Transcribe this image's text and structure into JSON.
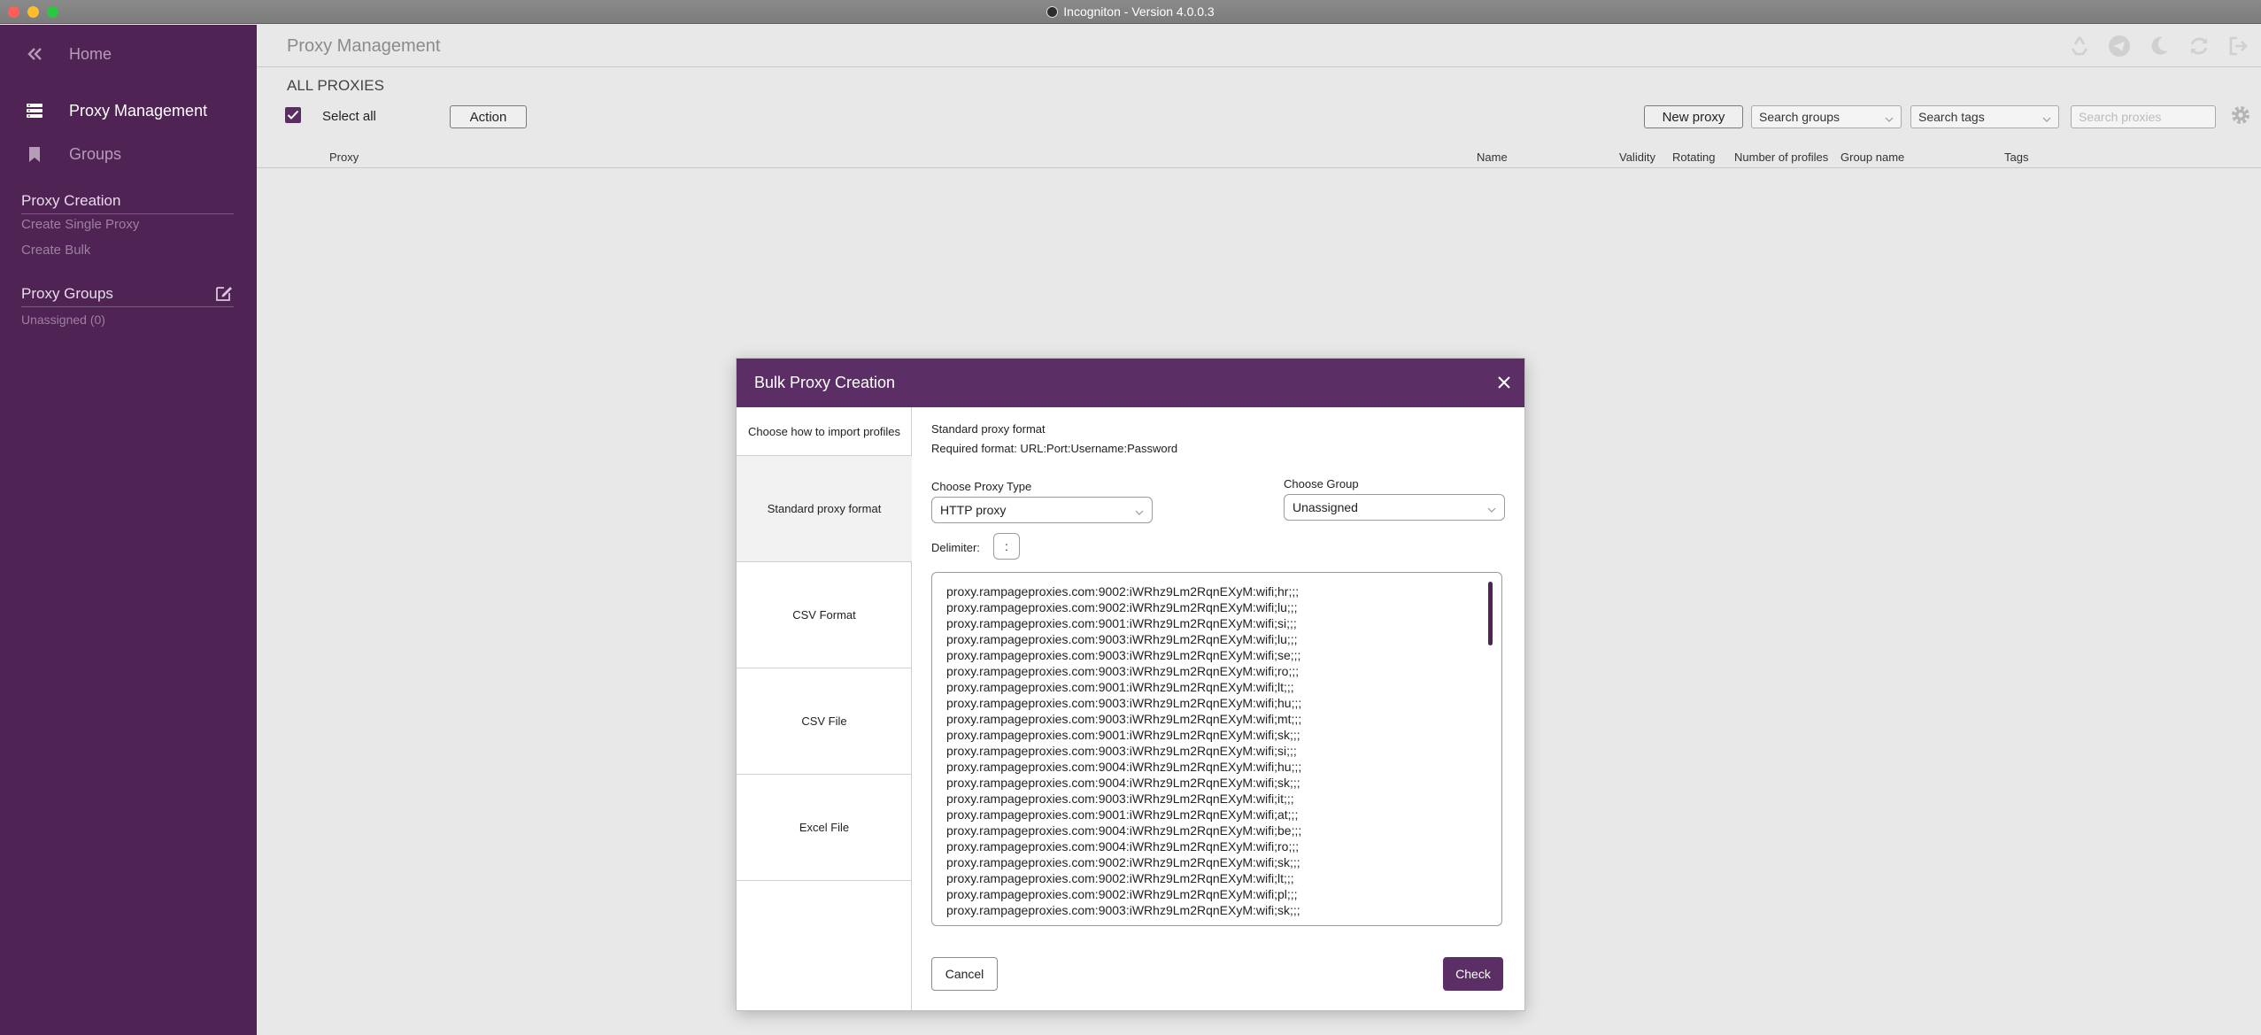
{
  "window": {
    "title": "Incogniton - Version 4.0.0.3"
  },
  "sidebar": {
    "collapse_icon": "double-chevron-left-icon",
    "nav": [
      {
        "label": "Home",
        "icon": "chevrons-left-icon"
      },
      {
        "label": "Proxy Management",
        "icon": "server-stack-icon"
      },
      {
        "label": "Groups",
        "icon": "bookmark-icon"
      }
    ],
    "proxy_creation": {
      "heading": "Proxy Creation",
      "links": [
        "Create Single Proxy",
        "Create Bulk"
      ]
    },
    "proxy_groups": {
      "heading": "Proxy Groups",
      "items": [
        "Unassigned (0)"
      ]
    }
  },
  "header": {
    "title": "Proxy Management",
    "icons": [
      "recycle-icon",
      "telegram-icon",
      "moon-icon",
      "refresh-icon",
      "logout-icon"
    ]
  },
  "toolbar": {
    "section_title": "ALL PROXIES",
    "select_all": "Select all",
    "action": "Action",
    "new_proxy": "New proxy",
    "search_groups": "Search groups",
    "search_tags": "Search tags",
    "search_proxies_placeholder": "Search proxies"
  },
  "table": {
    "columns": [
      "Proxy",
      "Name",
      "Validity",
      "Rotating",
      "Number of profiles",
      "Group name",
      "Tags"
    ]
  },
  "modal": {
    "title": "Bulk Proxy Creation",
    "left": {
      "hint": "Choose how to import profiles",
      "tabs": [
        "Standard proxy format",
        "CSV Format",
        "CSV File",
        "Excel File"
      ]
    },
    "format_title": "Standard proxy format",
    "format_required": "Required format: URL:Port:Username:Password",
    "proxy_type_label": "Choose Proxy Type",
    "proxy_type_value": "HTTP proxy",
    "group_label": "Choose Group",
    "group_value": "Unassigned",
    "delimiter_label": "Delimiter:",
    "delimiter_value": ":",
    "lines": [
      "proxy.rampageproxies.com:9002:iWRhz9Lm2RqnEXyM:wifi;hr;;;",
      "proxy.rampageproxies.com:9002:iWRhz9Lm2RqnEXyM:wifi;lu;;;",
      "proxy.rampageproxies.com:9001:iWRhz9Lm2RqnEXyM:wifi;si;;;",
      "proxy.rampageproxies.com:9003:iWRhz9Lm2RqnEXyM:wifi;lu;;;",
      "proxy.rampageproxies.com:9003:iWRhz9Lm2RqnEXyM:wifi;se;;;",
      "proxy.rampageproxies.com:9003:iWRhz9Lm2RqnEXyM:wifi;ro;;;",
      "proxy.rampageproxies.com:9001:iWRhz9Lm2RqnEXyM:wifi;lt;;;",
      "proxy.rampageproxies.com:9003:iWRhz9Lm2RqnEXyM:wifi;hu;;;",
      "proxy.rampageproxies.com:9003:iWRhz9Lm2RqnEXyM:wifi;mt;;;",
      "proxy.rampageproxies.com:9001:iWRhz9Lm2RqnEXyM:wifi;sk;;;",
      "proxy.rampageproxies.com:9003:iWRhz9Lm2RqnEXyM:wifi;si;;;",
      "proxy.rampageproxies.com:9004:iWRhz9Lm2RqnEXyM:wifi;hu;;;",
      "proxy.rampageproxies.com:9004:iWRhz9Lm2RqnEXyM:wifi;sk;;;",
      "proxy.rampageproxies.com:9003:iWRhz9Lm2RqnEXyM:wifi;it;;;",
      "proxy.rampageproxies.com:9001:iWRhz9Lm2RqnEXyM:wifi;at;;;",
      "proxy.rampageproxies.com:9004:iWRhz9Lm2RqnEXyM:wifi;be;;;",
      "proxy.rampageproxies.com:9004:iWRhz9Lm2RqnEXyM:wifi;ro;;;",
      "proxy.rampageproxies.com:9002:iWRhz9Lm2RqnEXyM:wifi;sk;;;",
      "proxy.rampageproxies.com:9002:iWRhz9Lm2RqnEXyM:wifi;lt;;;",
      "proxy.rampageproxies.com:9002:iWRhz9Lm2RqnEXyM:wifi;pl;;;",
      "proxy.rampageproxies.com:9003:iWRhz9Lm2RqnEXyM:wifi;sk;;;"
    ],
    "cancel": "Cancel",
    "check": "Check"
  },
  "colors": {
    "accent": "#5b2e66",
    "sidebar_bg": "#4f2354"
  }
}
